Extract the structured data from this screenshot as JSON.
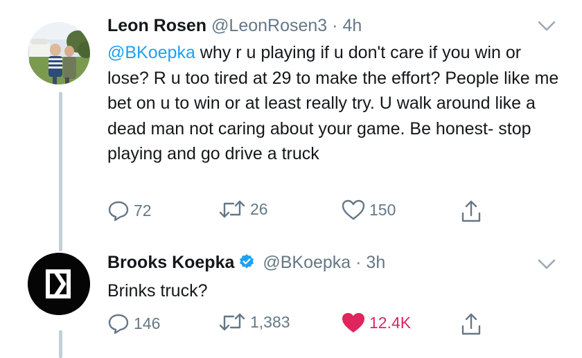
{
  "tweets": [
    {
      "name": "Leon Rosen",
      "handle": "@LeonRosen3",
      "separator": "·",
      "time": "4h",
      "mention": "@BKoepka",
      "text": " why r u playing if u don't care if you win or lose? R u too tired at 29 to make the effort? People like me bet on u to win or at least really try. U walk around like a dead man not caring about your game. Be honest- stop playing and go drive a truck",
      "replies": "72",
      "retweets": "26",
      "likes": "150",
      "liked": false
    },
    {
      "name": "Brooks Koepka",
      "handle": "@BKoepka",
      "separator": "·",
      "time": "3h",
      "verified": true,
      "text": "Brinks truck?",
      "replies": "146",
      "retweets": "1,383",
      "likes": "12.4K",
      "liked": true
    }
  ],
  "colors": {
    "accent": "#1da1f2",
    "muted": "#657786",
    "like": "#e0245e",
    "thread_line": "#c4cfd6"
  },
  "icons": [
    "chevron-down-icon",
    "reply-icon",
    "retweet-icon",
    "heart-icon",
    "share-icon",
    "verified-badge-icon",
    "kb-logo-icon"
  ]
}
